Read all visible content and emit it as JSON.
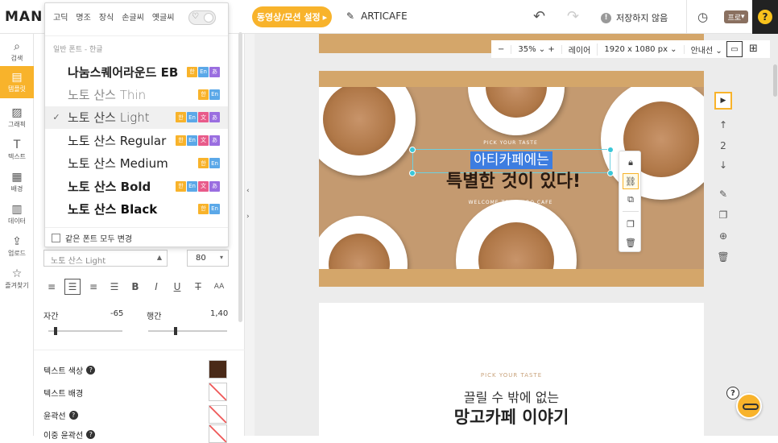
{
  "app": {
    "logo": "MAN"
  },
  "topbar": {
    "video_button": "동영상/모션 설정",
    "video_arrow": "▸",
    "doc_title": "ARTICAFE",
    "save_status": "저장하지 않음",
    "pro_badge": "프로",
    "help": "?"
  },
  "rail": {
    "items": [
      {
        "label": "검색",
        "icon": "⌕"
      },
      {
        "label": "템플릿",
        "icon": "▤"
      },
      {
        "label": "그래픽",
        "icon": "▨"
      },
      {
        "label": "텍스트",
        "icon": "T"
      },
      {
        "label": "배경",
        "icon": "▦"
      },
      {
        "label": "데이터",
        "icon": "▥"
      },
      {
        "label": "업로드",
        "icon": "⇪"
      },
      {
        "label": "즐겨찾기",
        "icon": "☆"
      }
    ]
  },
  "font_dropdown": {
    "tabs": [
      "고딕",
      "명조",
      "장식",
      "손글씨",
      "옛글씨"
    ],
    "category": "일반 폰트 - 한글",
    "fonts": [
      {
        "name": "나눔스퀘어라운드 EB",
        "badges": [
          "한",
          "En",
          "あ"
        ],
        "weight": "bold",
        "color": "#222"
      },
      {
        "name": "노토 산스 Thin",
        "badges": [
          "한",
          "En"
        ],
        "weight": "200",
        "color": "#888"
      },
      {
        "name": "노토 산스 Light",
        "badges": [
          "한",
          "En",
          "文",
          "あ"
        ],
        "weight": "300",
        "color": "#444",
        "selected": true
      },
      {
        "name": "노토 산스 Regular",
        "badges": [
          "한",
          "En",
          "文",
          "あ"
        ],
        "weight": "normal",
        "color": "#222"
      },
      {
        "name": "노토 산스 Medium",
        "badges": [
          "한",
          "En"
        ],
        "weight": "500",
        "color": "#222"
      },
      {
        "name": "노토 산스 Bold",
        "badges": [
          "한",
          "En",
          "文",
          "あ"
        ],
        "weight": "bold",
        "color": "#222"
      },
      {
        "name": "노토 산스 Black",
        "badges": [
          "한",
          "En"
        ],
        "weight": "900",
        "color": "#111"
      }
    ],
    "change_all_label": "같은 폰트 모두 변경"
  },
  "text_panel": {
    "font_value": "노토 산스 Light",
    "size_value": "80",
    "letter_spacing_label": "자간",
    "letter_spacing_value": "-65",
    "line_height_label": "행간",
    "line_height_value": "1,40",
    "letter_spacing_pct": 0.1,
    "line_height_pct": 0.35,
    "props": [
      {
        "label": "텍스트 색상",
        "help": true,
        "color": "#4a2a18"
      },
      {
        "label": "텍스트 배경",
        "help": false,
        "color": null
      },
      {
        "label": "윤곽선",
        "help": true,
        "color": null
      },
      {
        "label": "이중 윤곽선",
        "help": true,
        "color": null
      }
    ]
  },
  "canvas_toolbar": {
    "zoom_out": "−",
    "zoom": "35%",
    "zoom_in": "+",
    "layer": "레이어",
    "dimensions": "1920 x 1080 px",
    "guide": "안내선"
  },
  "canvas": {
    "page2": {
      "badge_top": "PICK YOUR TASTE",
      "selected_text": "아티카페에는",
      "headline": "특별한 것이 있다!",
      "badge_bottom": "WELCOME TO MANGO CAFE"
    },
    "page3": {
      "small": "PICK YOUR TASTE",
      "line1": "끌릴 수 밖에 없는",
      "line2": "망고카페 이야기"
    }
  },
  "right_rail": {
    "page_number": "2"
  }
}
